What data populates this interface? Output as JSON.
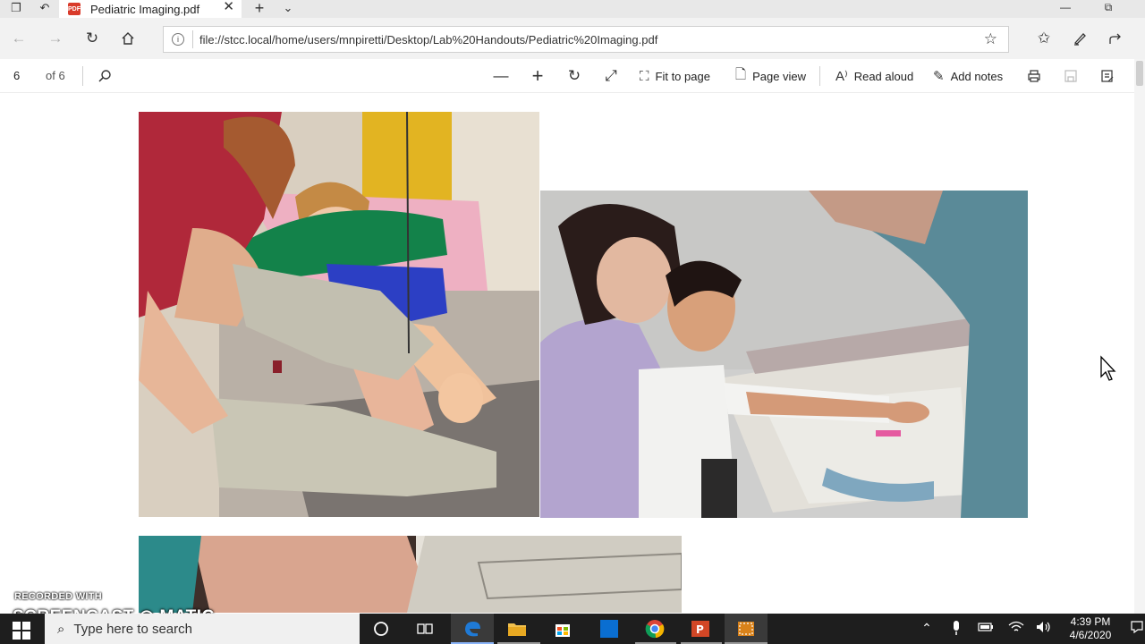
{
  "browser": {
    "tab": {
      "title": "Pediatric Imaging.pdf",
      "badge": "PDF"
    },
    "address": {
      "url": "file://stcc.local/home/users/mnpiretti/Desktop/Lab%20Handouts/Pediatric%20Imaging.pdf"
    },
    "icons": {
      "back": "back-arrow-icon",
      "forward": "forward-arrow-icon",
      "refresh": "refresh-icon",
      "home": "home-icon",
      "favorite": "star-icon",
      "favorites_list": "favorites-icon",
      "pen": "pen-icon",
      "share": "share-icon"
    }
  },
  "pdf_toolbar": {
    "page_current": "6",
    "page_total": "of 6",
    "fit_to_page": "Fit to page",
    "page_view": "Page view",
    "read_aloud": "Read aloud",
    "add_notes": "Add notes"
  },
  "watermark": {
    "line1": "RECORDED WITH",
    "line2": "SCREENCAST ◎ MATIC"
  },
  "taskbar": {
    "search_placeholder": "Type here to search",
    "time": "4:39 PM",
    "date": "4/6/2020"
  },
  "colors": {
    "taskbar": "#1e1e1e",
    "pdf_red": "#d93b2b",
    "edge_blue": "#1f7ad6"
  }
}
